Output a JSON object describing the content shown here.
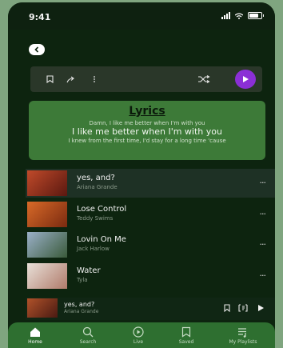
{
  "status_bar": {
    "time": "9:41"
  },
  "lyrics": {
    "title": "Lyrics",
    "line1": "Damn, I like me better when I'm with you",
    "line2": "I like me better when I'm with you",
    "line3": "I knew from the first time, I'd stay for a long time 'cause"
  },
  "songs": [
    {
      "title": "yes, and?",
      "artist": "Ariana Grande",
      "more": "···",
      "art_colors": [
        "#c04a2a",
        "#5a1810"
      ]
    },
    {
      "title": "Lose Control",
      "artist": "Teddy Swims",
      "more": "···",
      "art_colors": [
        "#d86a28",
        "#7a2a10"
      ]
    },
    {
      "title": "Lovin On Me",
      "artist": "Jack Harlow",
      "more": "···",
      "art_colors": [
        "#9ab0c8",
        "#3a5a3a"
      ]
    },
    {
      "title": "Water",
      "artist": "Tyla",
      "more": "···",
      "art_colors": [
        "#e8e0d8",
        "#b07a6a"
      ]
    }
  ],
  "now_playing": {
    "title": "yes, and?",
    "artist": "Ariana Grande"
  },
  "nav": [
    {
      "label": "Home",
      "icon": "home-icon",
      "active": true
    },
    {
      "label": "Search",
      "icon": "search-icon",
      "active": false
    },
    {
      "label": "Live",
      "icon": "live-icon",
      "active": false
    },
    {
      "label": "Saved",
      "icon": "bookmark-icon",
      "active": false
    },
    {
      "label": "My Playlists",
      "icon": "playlist-icon",
      "active": false
    }
  ],
  "colors": {
    "accent": "#8b2fd6",
    "background": "#0d240f",
    "lyrics_card": "#3d7a38",
    "nav_bar": "#2e6f30"
  }
}
